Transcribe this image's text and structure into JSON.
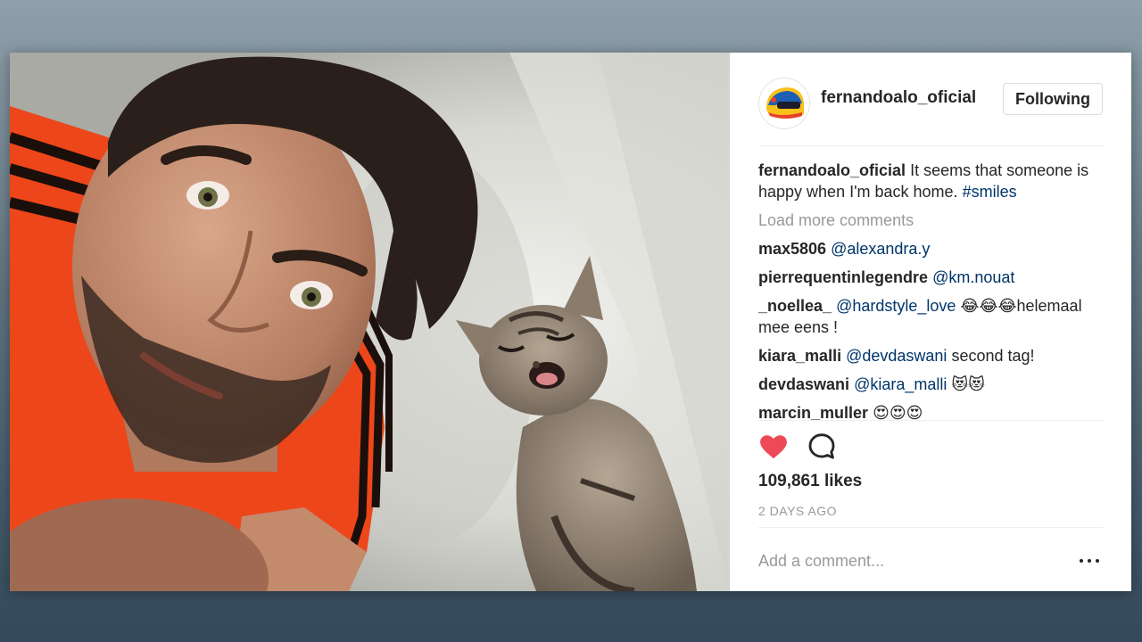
{
  "header": {
    "username": "fernandoalo_oficial",
    "follow_label": "Following"
  },
  "caption": {
    "username": "fernandoalo_oficial",
    "text": "It seems that someone is happy when I'm back home.",
    "hashtag": "#smiles"
  },
  "load_more_label": "Load more comments",
  "comments": [
    {
      "user": "max5806",
      "mention": "@alexandra.y",
      "text": ""
    },
    {
      "user": "pierrequentinlegendre",
      "mention": "@km.nouat",
      "text": ""
    },
    {
      "user": "_noellea_",
      "mention": "@hardstyle_love",
      "text": "😂😂😂helemaal mee eens !"
    },
    {
      "user": "kiara_malli",
      "mention": "@devdaswani",
      "text": "second tag!"
    },
    {
      "user": "devdaswani",
      "mention": "@kiara_malli",
      "text": "😻😻"
    },
    {
      "user": "marcin_muller",
      "mention": "",
      "text": "😍😍😍"
    }
  ],
  "actions": {
    "like_icon": "heart-filled-icon",
    "comment_icon": "speech-bubble-icon",
    "liked": true
  },
  "likes_label": "109,861 likes",
  "timestamp": "2 DAYS AGO",
  "add_comment_placeholder": "Add a comment...",
  "colors": {
    "heart": "#ed4956",
    "mention": "#003569",
    "muted": "#999999",
    "text": "#262626"
  }
}
